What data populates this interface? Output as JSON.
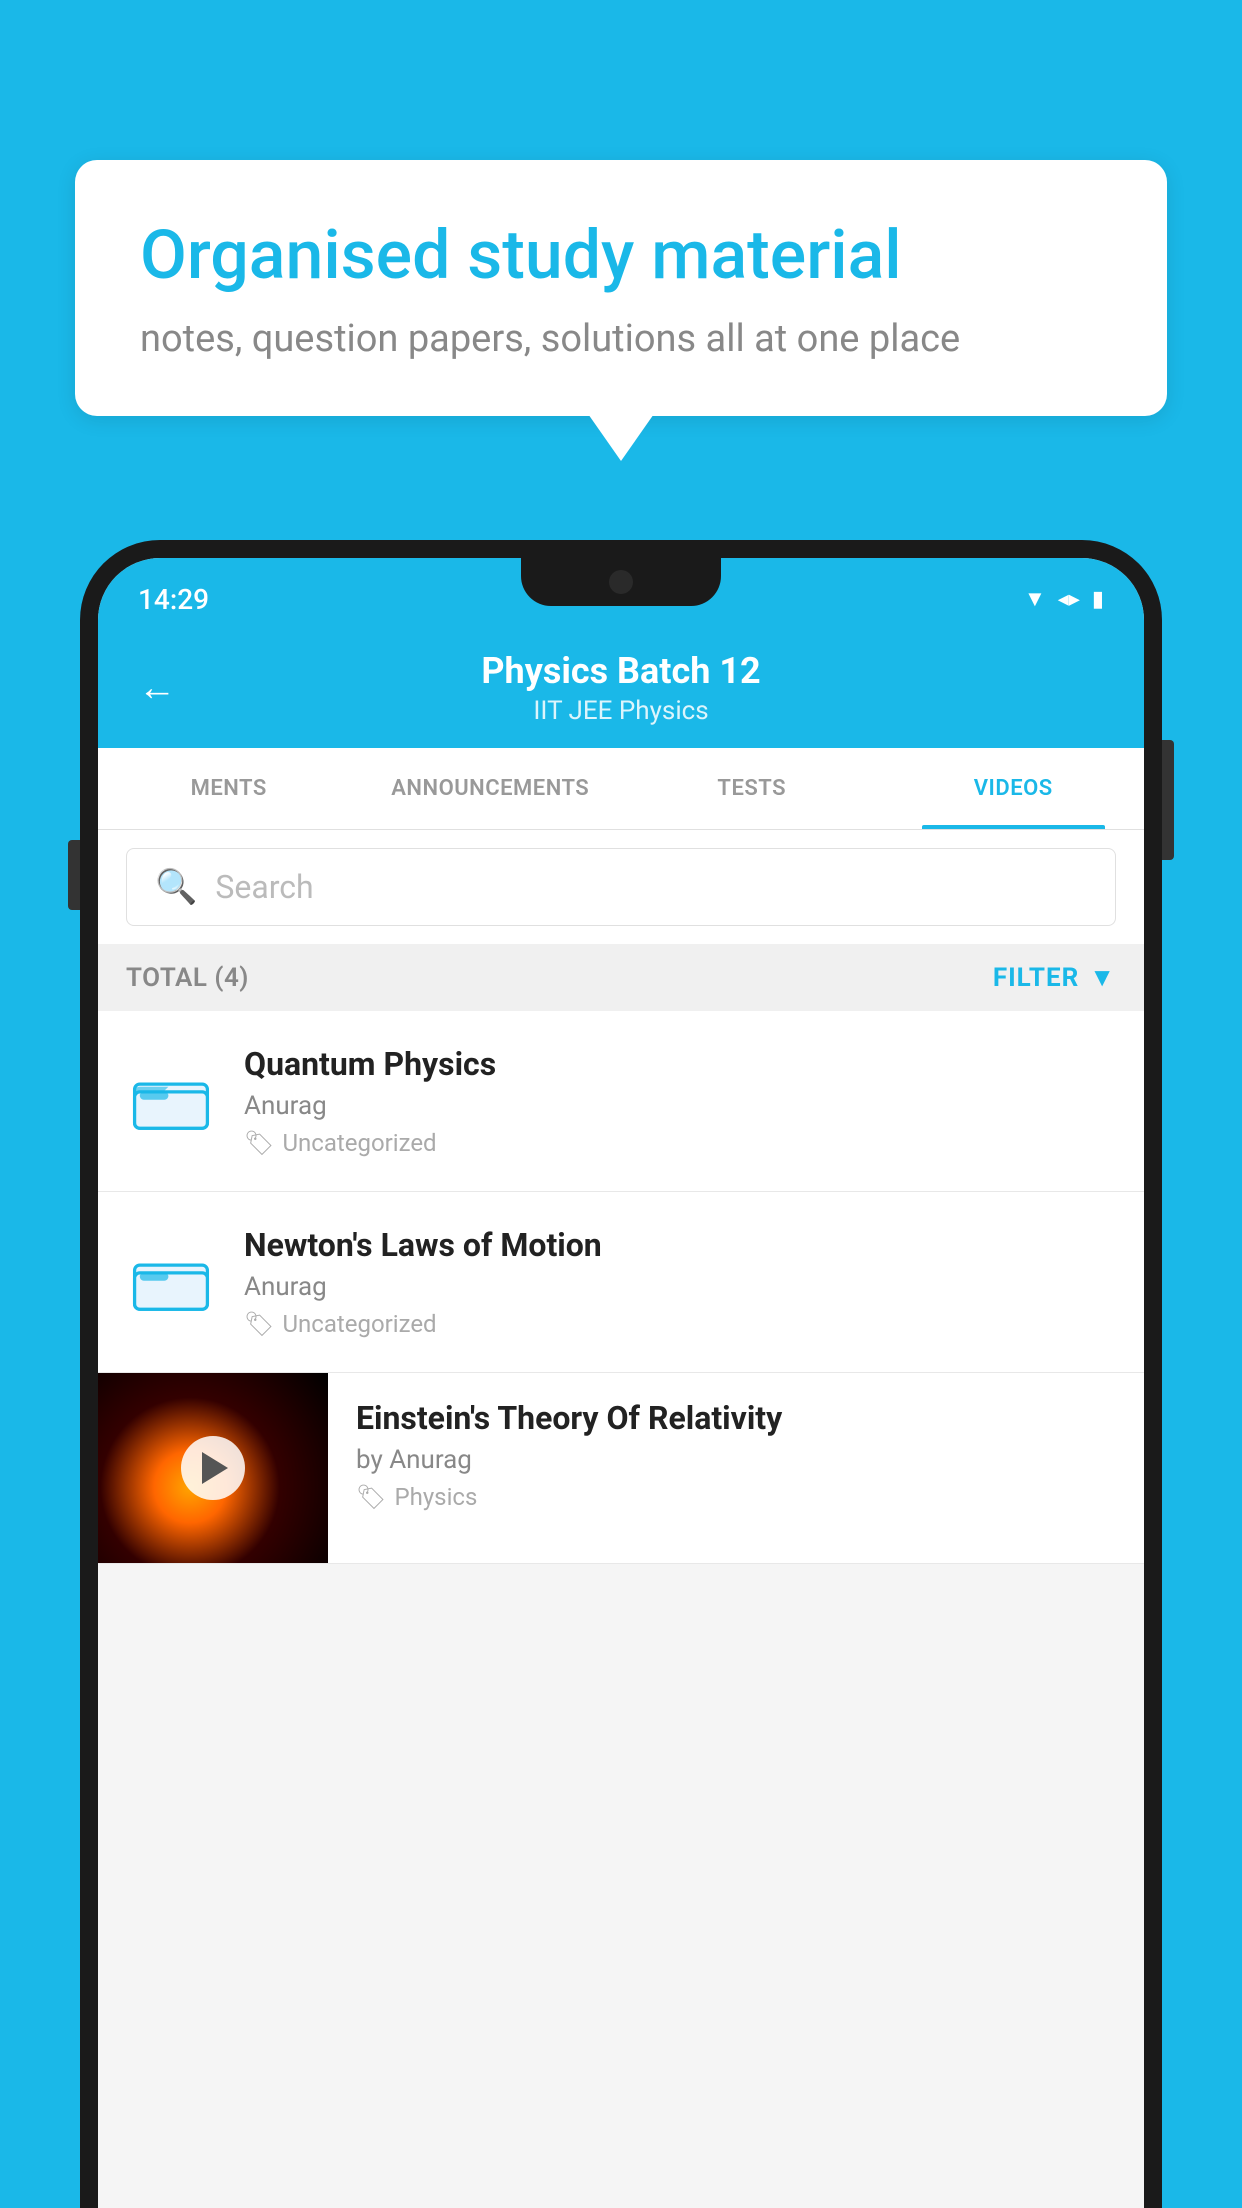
{
  "background_color": "#1ab8e8",
  "speech_bubble": {
    "title": "Organised study material",
    "subtitle": "notes, question papers, solutions all at one place"
  },
  "status_bar": {
    "time": "14:29",
    "icons": [
      "wifi",
      "signal",
      "battery"
    ]
  },
  "header": {
    "back_label": "←",
    "title": "Physics Batch 12",
    "subtitle_tags": "IIT JEE   Physics"
  },
  "tabs": [
    {
      "label": "MENTS",
      "active": false
    },
    {
      "label": "ANNOUNCEMENTS",
      "active": false
    },
    {
      "label": "TESTS",
      "active": false
    },
    {
      "label": "VIDEOS",
      "active": true
    }
  ],
  "search": {
    "placeholder": "Search"
  },
  "filter_bar": {
    "total_label": "TOTAL (4)",
    "filter_label": "FILTER"
  },
  "videos": [
    {
      "title": "Quantum Physics",
      "author": "Anurag",
      "tag": "Uncategorized",
      "has_thumbnail": false
    },
    {
      "title": "Newton's Laws of Motion",
      "author": "Anurag",
      "tag": "Uncategorized",
      "has_thumbnail": false
    },
    {
      "title": "Einstein's Theory Of Relativity",
      "author": "by Anurag",
      "tag": "Physics",
      "has_thumbnail": true
    }
  ]
}
